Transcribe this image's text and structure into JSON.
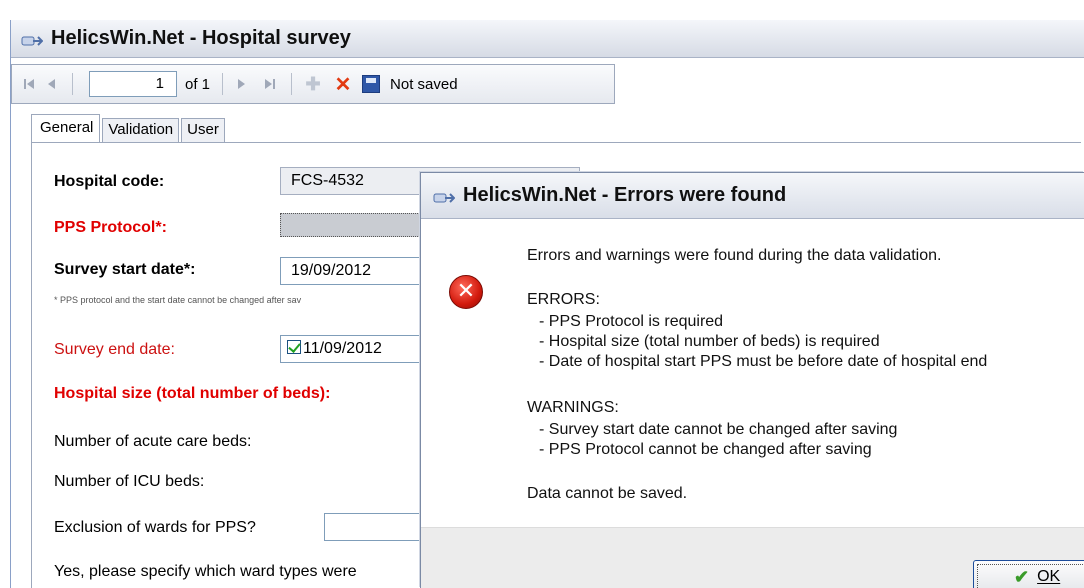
{
  "main_window": {
    "title": "HelicsWin.Net - Hospital survey",
    "navigator": {
      "current_page": "1",
      "of_text": "of 1",
      "status": "Not saved"
    },
    "tabs": [
      "General",
      "Validation",
      "User"
    ],
    "form": {
      "hospital_code_label": "Hospital code:",
      "hospital_code_value": "FCS-4532",
      "pps_protocol_label": "PPS Protocol*:",
      "survey_start_label": "Survey start date*:",
      "survey_start_value": "19/09/2012",
      "note": "* PPS protocol and the start date cannot be changed after sav",
      "survey_end_label": "Survey end date:",
      "survey_end_value": "11/09/2012",
      "survey_end_checked": true,
      "hospital_size_label": "Hospital size (total number of beds):",
      "acute_beds_label": "Number of acute care beds:",
      "icu_beds_label": "Number of ICU beds:",
      "exclusion_label": "Exclusion of wards for PPS?",
      "specify_label": "Yes, please specify which ward types were"
    }
  },
  "dialog": {
    "title": "HelicsWin.Net - Errors were found",
    "intro": "Errors and warnings were found during the data validation.",
    "errors_heading": "ERRORS:",
    "errors": [
      "- PPS Protocol is required",
      "- Hospital size (total number of beds) is required",
      "- Date of hospital start PPS must be before date of hospital end"
    ],
    "warnings_heading": "WARNINGS:",
    "warnings": [
      "- Survey start date cannot be changed after saving",
      "- PPS Protocol cannot be changed after saving"
    ],
    "footer_message": "Data cannot be saved.",
    "ok_label": "OK"
  }
}
